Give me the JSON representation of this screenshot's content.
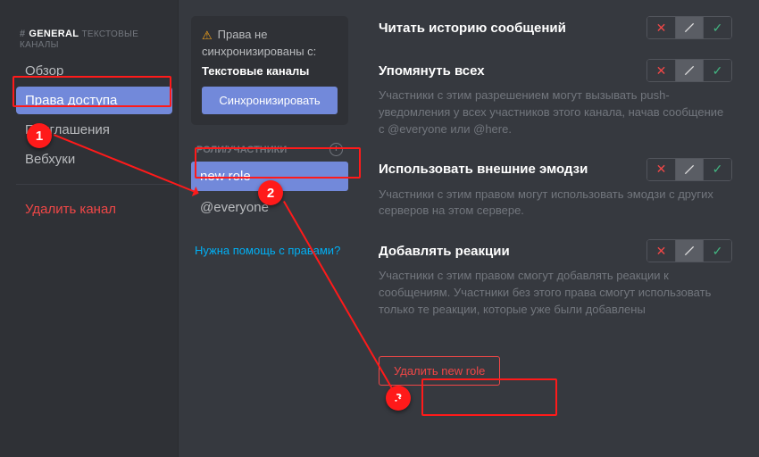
{
  "sidebar": {
    "header_hash": "#",
    "header_name": "GENERAL",
    "header_sub": "ТЕКСТОВЫЕ КАНАЛЫ",
    "items": [
      {
        "label": "Обзор"
      },
      {
        "label": "Права доступа"
      },
      {
        "label": "Приглашения"
      },
      {
        "label": "Вебхуки"
      }
    ],
    "delete": "Удалить канал"
  },
  "sync": {
    "line1": "Права не синхронизированы с:",
    "line2": "Текстовые каналы",
    "button": "Синхронизировать"
  },
  "roles": {
    "header": "РОЛИ/УЧАСТНИКИ",
    "items": [
      {
        "label": "new role"
      },
      {
        "label": "@everyone"
      }
    ],
    "help": "Нужна помощь с правами?"
  },
  "perms": [
    {
      "title": "Читать историю сообщений",
      "desc": ""
    },
    {
      "title": "Упомянуть всех",
      "desc": "Участники с этим разрешением могут вызывать push-уведомления у всех участников этого канала, начав сообщение с @everyone или @here."
    },
    {
      "title": "Использовать внешние эмодзи",
      "desc": "Участники с этим правом могут использовать эмодзи с других серверов на этом сервере."
    },
    {
      "title": "Добавлять реакции",
      "desc": "Участники с этим правом смогут добавлять реакции к сообщениям. Участники без этого права смогут использовать только те реакции, которые уже были добавлены"
    }
  ],
  "deleteRole": "Удалить new role",
  "annot": {
    "badge1": "1",
    "badge2": "2",
    "badge3": "3"
  }
}
